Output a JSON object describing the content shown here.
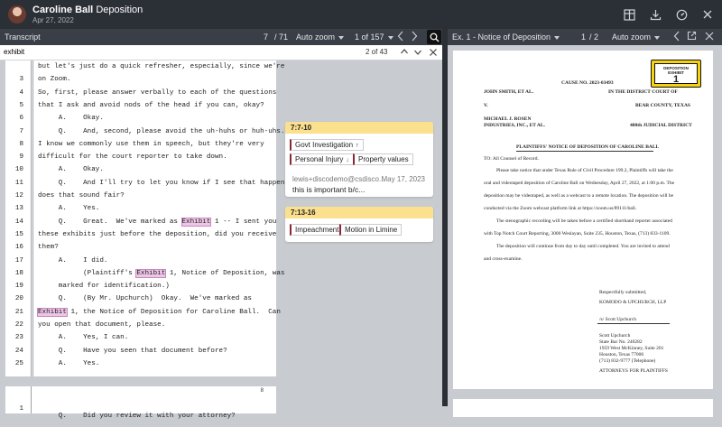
{
  "header": {
    "name": "Caroline Ball",
    "title_suffix": "Deposition",
    "date": "Apr 27, 2022"
  },
  "transcript_toolbar": {
    "title": "Transcript",
    "page_current": "7",
    "page_total": "/ 71",
    "zoom": "Auto zoom",
    "range": "1 of 157"
  },
  "search": {
    "value": "exhibit",
    "count": "2 of 43"
  },
  "transcript": {
    "lines": [
      {
        "n": "",
        "pre": "but let's just do a quick refresher, especially, since we're",
        "hl": "",
        "post": ""
      },
      {
        "n": "3",
        "pre": "on Zoom.",
        "hl": "",
        "post": ""
      },
      {
        "n": "4",
        "pre": "So, first, please answer verbally to each of the questions",
        "hl": "",
        "post": ""
      },
      {
        "n": "5",
        "pre": "that I ask and avoid nods of the head if you can, okay?",
        "hl": "",
        "post": ""
      },
      {
        "n": "6",
        "pre": "     A.    Okay.",
        "hl": "",
        "post": ""
      },
      {
        "n": "7",
        "pre": "     Q.    And, second, please avoid the uh-huhs or huh-uhs.",
        "hl": "",
        "post": ""
      },
      {
        "n": "8",
        "pre": "I know we commonly use them in speech, but they're very",
        "hl": "",
        "post": ""
      },
      {
        "n": "9",
        "pre": "difficult for the court reporter to take down.",
        "hl": "",
        "post": ""
      },
      {
        "n": "10",
        "pre": "     A.    Okay.",
        "hl": "",
        "post": ""
      },
      {
        "n": "11",
        "pre": "     Q.    And I'll try to let you know if I see that happen;",
        "hl": "",
        "post": ""
      },
      {
        "n": "12",
        "pre": "does that sound fair?",
        "hl": "",
        "post": ""
      },
      {
        "n": "13",
        "pre": "     A.    Yes.",
        "hl": "",
        "post": ""
      },
      {
        "n": "14",
        "pre": "     Q.    Great.  We've marked as ",
        "hl": "Exhibit",
        "post": " 1 -- I sent you"
      },
      {
        "n": "15",
        "pre": "these exhibits just before the deposition, did you receive",
        "hl": "",
        "post": ""
      },
      {
        "n": "16",
        "pre": "them?",
        "hl": "",
        "post": ""
      },
      {
        "n": "17",
        "pre": "     A.    I did.",
        "hl": "",
        "post": ""
      },
      {
        "n": "18",
        "pre": "           (Plaintiff's ",
        "hl": "Exhibit",
        "post": " 1, Notice of Deposition, was"
      },
      {
        "n": "19",
        "pre": "     marked for identification.)",
        "hl": "",
        "post": ""
      },
      {
        "n": "20",
        "pre": "     Q.    (By Mr. Upchurch)  Okay.  We've marked as",
        "hl": "",
        "post": ""
      },
      {
        "n": "21",
        "pre": "",
        "hl": "Exhibit",
        "post": " 1, the Notice of Deposition for Caroline Ball.  Can"
      },
      {
        "n": "22",
        "pre": "you open that document, please.",
        "hl": "",
        "post": ""
      },
      {
        "n": "23",
        "pre": "     A.    Yes, I can.",
        "hl": "",
        "post": ""
      },
      {
        "n": "24",
        "pre": "     Q.    Have you seen that document before?",
        "hl": "",
        "post": ""
      },
      {
        "n": "25",
        "pre": "     A.    Yes.",
        "hl": "",
        "post": ""
      }
    ],
    "next_page_no": "8",
    "next_line": {
      "n": "1",
      "text": "     Q.    Did you review it with your attorney?"
    }
  },
  "annotations": [
    {
      "range": "7:7-10",
      "tags": [
        {
          "label": "Govt Investigation",
          "arrow": "↑"
        },
        {
          "label": "Personal Injury",
          "arrow": "↓"
        },
        {
          "label": "Property values",
          "arrow": ""
        }
      ],
      "note_user": "lewis+discodemo@csdisco...",
      "note_date": "May 17, 2023",
      "note_text": "this is important b/c..."
    },
    {
      "range": "7:13-16",
      "tags": [
        {
          "label": "Impeachment",
          "arrow": ""
        },
        {
          "label": "Motion in Limine",
          "arrow": ""
        }
      ]
    }
  ],
  "exhibit_toolbar": {
    "title": "Ex. 1 - Notice of Deposition",
    "page_current": "1",
    "page_total": "/ 2",
    "zoom": "Auto zoom"
  },
  "exhibit_doc": {
    "sticker_label": "DEPOSITION EXHIBIT",
    "sticker_number": "1",
    "cause_no": "CAUSE NO. 2023-03493",
    "party1": "JOHN SMITH, ET AL.",
    "court1": "IN THE DISTRICT COURT OF",
    "v": "V.",
    "county": "BEAR COUNTY, TEXAS",
    "party2a": "MICHAEL J. ROSEN",
    "party2b": "INDUSTRIES, INC., ET AL.",
    "district": "480th JUDICIAL DISTRICT",
    "heading": "PLAINTIFFS' NOTICE OF DEPOSITION OF CAROLINE BALL",
    "to": "TO:     All Counsel of Record.",
    "p1": [
      "Please take notice that under Texas Rule of Civil Procedure 199.2, Plaintiffs will take the",
      "oral and videotaped deposition of Caroline Ball on Wednesday, April 27, 2022, at 1:00 p.m. The",
      "deposition may be videotaped, as well as a webcast to a remote location. The deposition will be",
      "conducted via the Zoom webcast platform link at https://zoom.us/89111/ball."
    ],
    "p2": [
      "The stenographic recording will be taken before a certified shorthand reporter associated",
      "with Top Notch Court Reporting, 3000 Weslayan, Suite 235, Houston, Texas, (713) 833-1109."
    ],
    "p3": [
      "The deposition will continue from day to day until completed. You are invited to attend",
      "and cross-examine."
    ],
    "signoff": "Respectfully submitted,",
    "firm": "KOMODO & UPCHURCH, LLP",
    "sig": "/s/  Scott Upchurch",
    "attorney": "Scott Upchurch",
    "bar": "State Bar No. 240282",
    "addr1": "1959 West McKinney, Suite 201",
    "addr2": "Houston, Texas 77006",
    "phone": "(713) 832-9777 (Telephone)",
    "role": "ATTORNEYS FOR PLAINTIFFS"
  }
}
